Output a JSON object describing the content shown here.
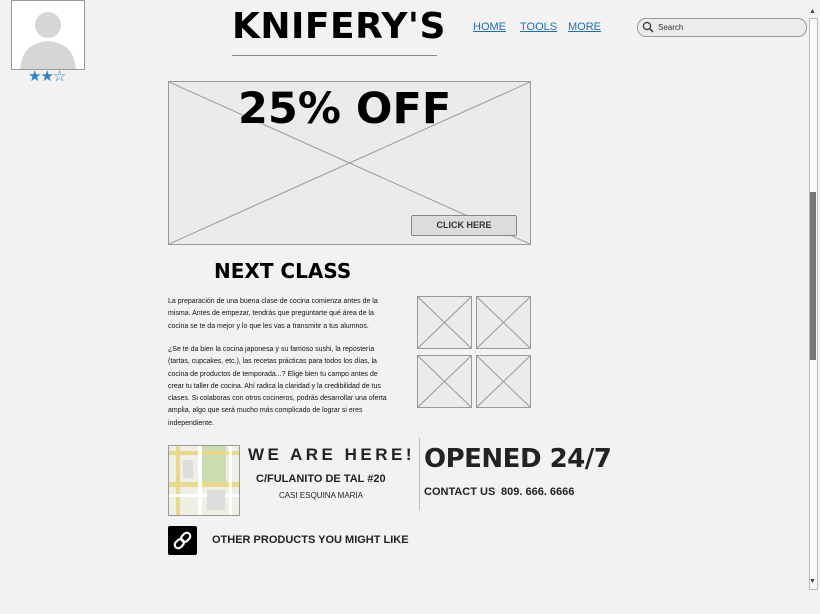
{
  "header": {
    "logo": "KNIFERY'S",
    "nav": [
      "HOME",
      "TOOLS",
      "MORE"
    ],
    "search_placeholder": "Search"
  },
  "profile": {
    "rating": 2,
    "rating_max": 3,
    "stars_text": "★★☆"
  },
  "promo": {
    "title": "25% OFF",
    "button": "CLICK HERE"
  },
  "next_class": {
    "title": "NEXT CLASS",
    "paragraphs": [
      "La preparación de una buena clase de cocina comienza antes de la misma. Antes de empezar, tendrás que preguntarte qué área de la cocina se te da mejor y lo que les vas a transmitir a tus alumnos.",
      "¿Se te da bien la cocina japonesa y su famoso sushi, la repostería (tartas, cupcakes, etc.), las recetas prácticas para todos los días, la cocina de productos de temporada...? Elige bien tu campo antes de crear tu taller de cocina. Ahí radica la claridad y la credibilidad de tus clases. Si colaboras con otros cocineros, podrás desarrollar una oferta amplia, algo que será mucho más complicado de lograr si eres independiente."
    ]
  },
  "location": {
    "title": "WE ARE HERE!",
    "address": "C/FULANITO DE TAL #20",
    "address_sub": "CASI ESQUINA MARIA"
  },
  "hours": {
    "title": "OPENED 24/7",
    "contact_label": "CONTACT US",
    "phone": "809. 666. 6666"
  },
  "footer": {
    "other_products": "OTHER PRODUCTS YOU MIGHT LIKE"
  }
}
